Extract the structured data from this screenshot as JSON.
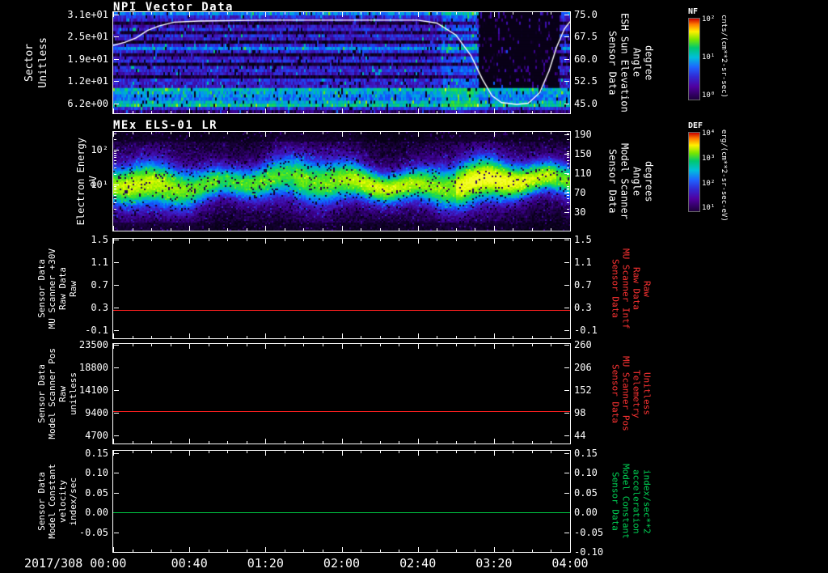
{
  "figure": {
    "background": "#000000",
    "text_color": "#ffffff",
    "xaxis": {
      "start_label": "2017/308 00:00",
      "tick_labels": [
        "00:40",
        "01:20",
        "02:00",
        "02:40",
        "03:20",
        "04:00"
      ],
      "tick_minutes": [
        40,
        80,
        120,
        160,
        200,
        240
      ],
      "range_minutes": [
        0,
        240
      ]
    }
  },
  "chart_data": [
    {
      "id": "npi-vector-data",
      "type": "heatmap",
      "title": "NPI Vector Data",
      "left_axis": {
        "label_lines": [
          "Sector",
          "Unitless"
        ],
        "tick_labels": [
          "3.1e+01",
          "2.5e+01",
          "1.9e+01",
          "1.2e+01",
          "6.2e+00"
        ]
      },
      "right_axis": {
        "label_lines": [
          "Sensor Data",
          "ESH Sun Elevation",
          "Angle",
          "degree"
        ],
        "tick_labels": [
          "75.0",
          "67.5",
          "60.0",
          "52.5",
          "45.0"
        ],
        "range": [
          75.0,
          45.0
        ]
      },
      "colorbar": {
        "name": "NF",
        "tick_labels": [
          "10²",
          "10¹",
          "10⁰"
        ],
        "units": "cnts/(cm**2-sr-sec)"
      },
      "heatmap": {
        "rows": 32,
        "row_intensities": [
          0.44,
          0.3,
          0.26,
          0.06,
          0.24,
          0.3,
          0.1,
          0.3,
          0.26,
          0.05,
          0.3,
          0.44,
          0.3,
          0.07,
          0.26,
          0.3,
          0.05,
          0.28,
          0.3,
          0.26,
          0.07,
          0.3,
          0.28,
          0.26,
          0.52,
          0.48,
          0.44,
          0.42,
          0.5,
          0.56,
          0.32,
          0.14
        ],
        "enhanced_minutes": [
          172,
          192
        ],
        "dropout_minutes": [
          192,
          234
        ],
        "dropout_rows": [
          0,
          23
        ]
      },
      "overlay_series": {
        "name": "ESH Sun Elevation Angle",
        "units": "degree",
        "color": "#ffffff",
        "points": [
          [
            0,
            64.5
          ],
          [
            6,
            65.5
          ],
          [
            12,
            67
          ],
          [
            18,
            69.5
          ],
          [
            24,
            71
          ],
          [
            32,
            72.3
          ],
          [
            45,
            72.7
          ],
          [
            80,
            73
          ],
          [
            120,
            73
          ],
          [
            160,
            73
          ],
          [
            170,
            72
          ],
          [
            180,
            68
          ],
          [
            188,
            61
          ],
          [
            194,
            53
          ],
          [
            199,
            47.5
          ],
          [
            204,
            45.2
          ],
          [
            212,
            44.6
          ],
          [
            218,
            45
          ],
          [
            224,
            48.5
          ],
          [
            229,
            56
          ],
          [
            233,
            64
          ],
          [
            237,
            70
          ],
          [
            240,
            72.5
          ]
        ]
      }
    },
    {
      "id": "mex-els-01-lr",
      "type": "heatmap",
      "title": "MEx ELS-01 LR",
      "left_axis": {
        "label_lines": [
          "Electron Energy",
          "eV"
        ],
        "scale": "log",
        "tick_labels": [
          "10²",
          "10¹"
        ]
      },
      "right_axis": {
        "label_lines": [
          "Sensor Data",
          "Model Scanner",
          "Angle",
          "degrees"
        ],
        "tick_labels": [
          "190",
          "150",
          "110",
          "70",
          "30"
        ],
        "range": [
          190,
          30
        ]
      },
      "colorbar": {
        "name": "DEF",
        "tick_labels": [
          "10⁴",
          "10³",
          "10²",
          "10¹"
        ],
        "units": "erg/(cm**2-sr-sec-eV)"
      },
      "heatmap": {
        "band_center_ev": 10,
        "amplitude_segments_minutes": [
          [
            0,
            55,
            0.6
          ],
          [
            55,
            95,
            0.52
          ],
          [
            95,
            180,
            0.6
          ],
          [
            180,
            232,
            0.74
          ],
          [
            232,
            240,
            0.64
          ]
        ]
      }
    },
    {
      "id": "mu-scanner-30v-raw",
      "type": "line",
      "left_axis": {
        "label_lines": [
          "Sensor Data",
          "MU Scanner +30V",
          "Raw Data",
          "Raw"
        ],
        "tick_labels": [
          "1.5",
          "1.1",
          "0.7",
          "0.3",
          "-0.1"
        ],
        "range": [
          1.5,
          -0.1
        ]
      },
      "right_axis": {
        "label_lines": [
          "Sensor Data",
          "MU Scanner Intf",
          "Raw Data",
          "Raw"
        ],
        "tick_labels": [
          "1.5",
          "1.1",
          "0.7",
          "0.3",
          "-0.1"
        ],
        "range": [
          1.5,
          -0.1
        ],
        "label_color": "#ff3333"
      },
      "series": [
        {
          "name": "MU Scanner +30V Raw",
          "color": "#ff2020",
          "constant_value": 0.25
        },
        {
          "name": "MU Scanner Intf Raw",
          "color": "#ff2020",
          "constant_value": 0.25,
          "axis": "right"
        }
      ]
    },
    {
      "id": "model-scanner-pos",
      "type": "line",
      "left_axis": {
        "label_lines": [
          "Sensor Data",
          "Model Scanner Pos",
          "Raw",
          "unitless"
        ],
        "tick_labels": [
          "23500",
          "18800",
          "14100",
          "9400",
          "4700"
        ],
        "range": [
          23500,
          4700
        ]
      },
      "right_axis": {
        "label_lines": [
          "Sensor Data",
          "MU Scanner Pos",
          "Telemetry",
          "Unitless"
        ],
        "tick_labels": [
          "260",
          "206",
          "152",
          "98",
          "44"
        ],
        "range": [
          260,
          44
        ],
        "label_color": "#ff3333"
      },
      "series": [
        {
          "name": "Model Scanner Pos Raw",
          "color": "#ff2020",
          "constant_value": 9700
        },
        {
          "name": "MU Scanner Pos Telemetry",
          "color": "#ff2020",
          "constant_value": 102,
          "axis": "right"
        }
      ]
    },
    {
      "id": "model-constant-velocity",
      "type": "line",
      "left_axis": {
        "label_lines": [
          "Sensor Data",
          "Model Constant",
          "velocity",
          "index/sec"
        ],
        "tick_labels": [
          "0.15",
          "0.10",
          "0.05",
          "0.00",
          "-0.05"
        ],
        "range": [
          0.15,
          -0.1
        ]
      },
      "right_axis": {
        "label_lines": [
          "Sensor Data",
          "Model Constant",
          "acceleration",
          "index/sec**2"
        ],
        "tick_labels": [
          "0.15",
          "0.10",
          "0.05",
          "0.00",
          "-0.05",
          "-0.10"
        ],
        "range": [
          0.15,
          -0.1
        ],
        "label_color": "#00d455"
      },
      "series": [
        {
          "name": "Model Constant velocity",
          "color": "#00cc44",
          "constant_value": 0.0
        },
        {
          "name": "Model Constant acceleration",
          "color": "#00cc44",
          "constant_value": 0.0,
          "axis": "right"
        }
      ]
    }
  ]
}
